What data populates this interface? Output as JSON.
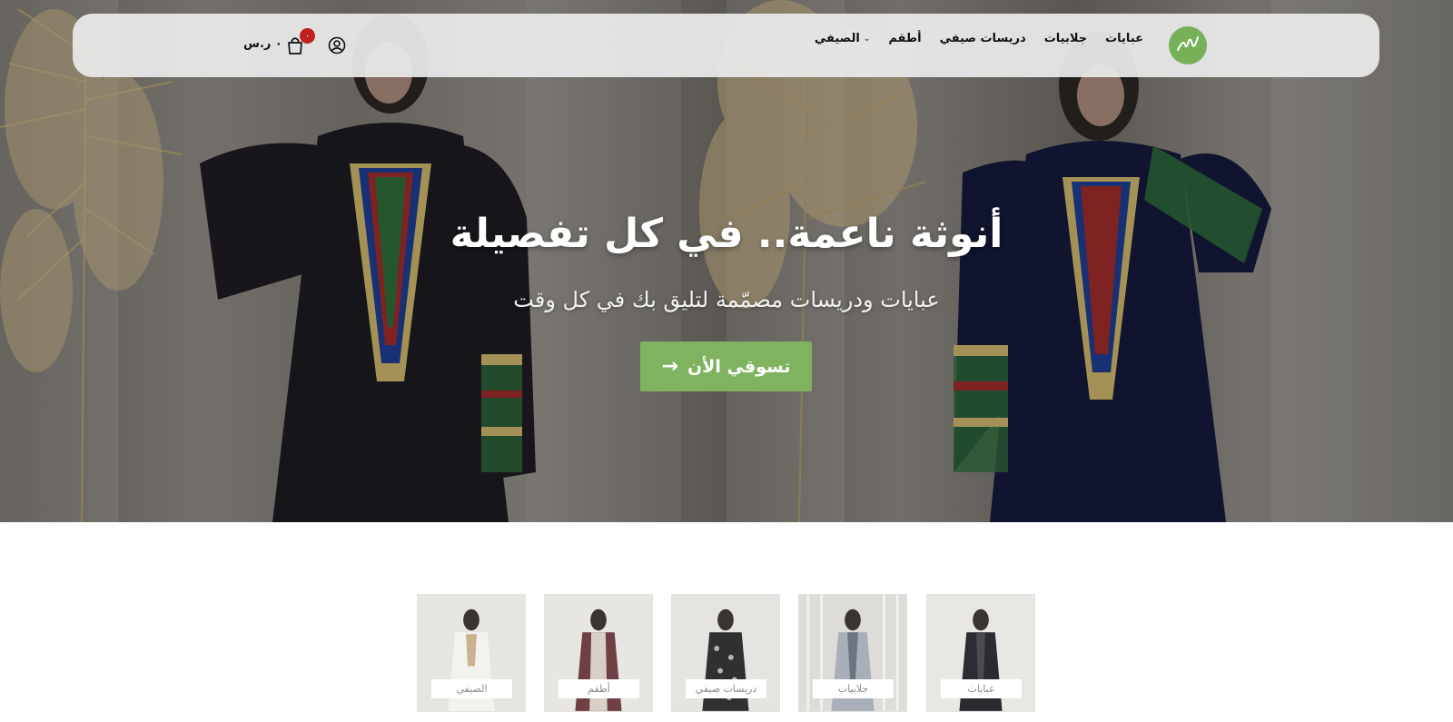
{
  "nav": {
    "logo_icon": "monogram-logo",
    "links": [
      {
        "label": "عبايات"
      },
      {
        "label": "جلابيات"
      },
      {
        "label": "دريسات صيفي"
      },
      {
        "label": "أطقم"
      },
      {
        "label": "الصيفي",
        "has_dropdown": true
      }
    ],
    "cart_count": "٠",
    "cart_total": "٠ ر.س",
    "icons": [
      "user-icon",
      "cart-icon",
      "chevron-down-icon",
      "arrow-right-icon"
    ]
  },
  "hero": {
    "title": "أنوثة ناعمة.. في كل تفصيلة",
    "subtitle": "عبايات ودريسات مصمّمة لتليق بك في كل وقت",
    "cta_label": "تسوقي الأن"
  },
  "categories": [
    {
      "label": "عبايات"
    },
    {
      "label": "جلابيات"
    },
    {
      "label": "دريسات صيفي"
    },
    {
      "label": "أطقم"
    },
    {
      "label": "الصيفي"
    }
  ],
  "colors": {
    "accent": "#7fb35f",
    "badge": "#c0211f",
    "nav_bg": "#ebebeb"
  }
}
